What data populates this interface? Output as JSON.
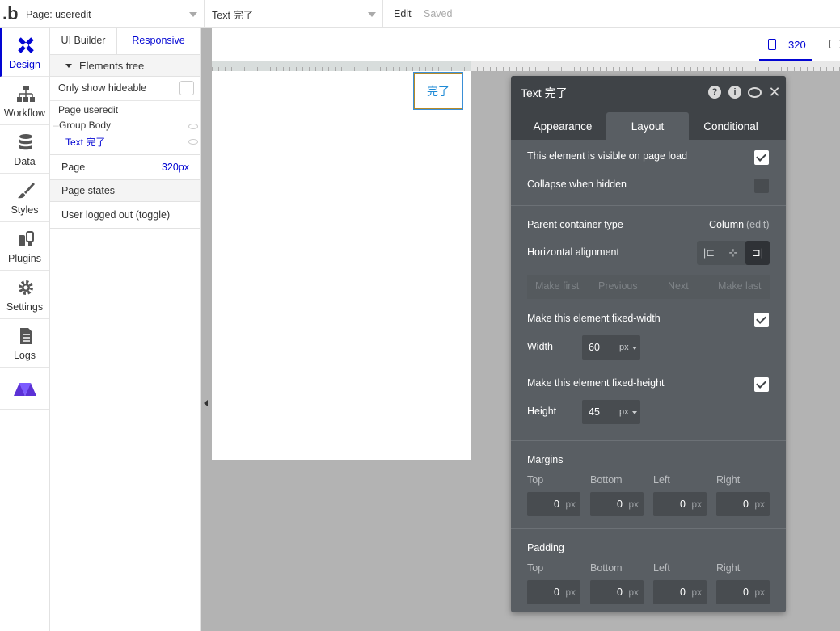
{
  "topbar": {
    "logo": ".b",
    "page_select": "Page: useredit",
    "element_select": "Text 完了",
    "edit_label": "Edit",
    "saved_label": "Saved"
  },
  "rail": [
    {
      "label": "Design",
      "icon": "design-icon",
      "active": true
    },
    {
      "label": "Workflow",
      "icon": "workflow-icon"
    },
    {
      "label": "Data",
      "icon": "database-icon"
    },
    {
      "label": "Styles",
      "icon": "brush-icon"
    },
    {
      "label": "Plugins",
      "icon": "plugin-icon"
    },
    {
      "label": "Settings",
      "icon": "gear-icon"
    },
    {
      "label": "Logs",
      "icon": "document-icon"
    },
    {
      "label": "",
      "icon": "bubble-logo-icon"
    }
  ],
  "panel": {
    "tab_ui": "UI Builder",
    "tab_responsive": "Responsive",
    "elements_tree": "Elements tree",
    "only_hideable": "Only show hideable",
    "tree": [
      "Page useredit",
      "Group Body",
      "Text 完了"
    ],
    "page_label": "Page",
    "page_value": "320px",
    "page_states": "Page states",
    "state_item": "User logged out (toggle)"
  },
  "canvas": {
    "viewport_width": "320",
    "text_element": "完了"
  },
  "editor": {
    "title": "Text 完了",
    "tabs": [
      "Appearance",
      "Layout",
      "Conditional"
    ],
    "active_tab": "Layout",
    "visible_on_load": "This element is visible on page load",
    "visible_on_load_checked": true,
    "collapse_when_hidden": "Collapse when hidden",
    "collapse_when_hidden_checked": false,
    "parent_container_label": "Parent container type",
    "parent_container_value": "Column",
    "parent_container_edit": "(edit)",
    "horizontal_alignment": "Horizontal alignment",
    "alignment_selected": "right",
    "order_buttons": [
      "Make first",
      "Previous",
      "Next",
      "Make last"
    ],
    "fixed_width_label": "Make this element fixed-width",
    "fixed_width_checked": true,
    "width_label": "Width",
    "width_value": "60",
    "width_unit": "px",
    "fixed_height_label": "Make this element fixed-height",
    "fixed_height_checked": true,
    "height_label": "Height",
    "height_value": "45",
    "height_unit": "px",
    "margins_title": "Margins",
    "padding_title": "Padding",
    "sides": [
      "Top",
      "Bottom",
      "Left",
      "Right"
    ],
    "margins": [
      "0",
      "0",
      "0",
      "0"
    ],
    "padding": [
      "0",
      "0",
      "0",
      "0"
    ],
    "unit": "px"
  }
}
